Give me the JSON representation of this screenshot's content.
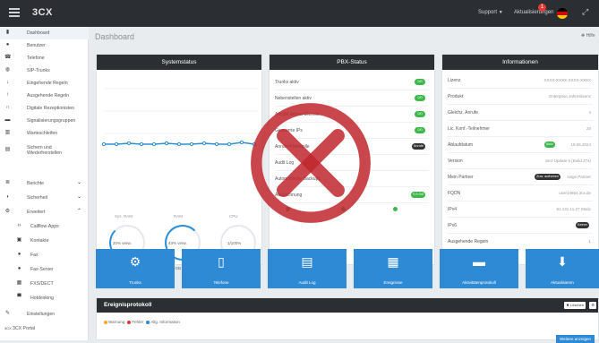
{
  "topbar": {
    "logo": "3CX",
    "support": "Support",
    "updates": "Aktualisierungen",
    "updates_badge": "1"
  },
  "sidebar": {
    "items": [
      {
        "label": "Dashboard",
        "icon": "chart-icon"
      },
      {
        "label": "Benutzer",
        "icon": "user-icon"
      },
      {
        "label": "Telefone",
        "icon": "phone-icon"
      },
      {
        "label": "SIP-Trunks",
        "icon": "globe-icon"
      },
      {
        "label": "Eingehende Regeln",
        "icon": "arrow-down-icon"
      },
      {
        "label": "Ausgehende Regeln",
        "icon": "arrow-up-icon"
      },
      {
        "label": "Digitale Rezeptionisten",
        "icon": "headset-icon"
      },
      {
        "label": "Signalisierungsgruppen",
        "icon": "group-icon"
      },
      {
        "label": "Warteschleifen",
        "icon": "queue-icon"
      },
      {
        "label": "Sichern und Wiederherstellen",
        "icon": "backup-icon"
      },
      {
        "label": "Berichte",
        "icon": "report-icon"
      },
      {
        "label": "Sicherheit",
        "icon": "shield-icon"
      },
      {
        "label": "Erweitert",
        "icon": "gear-icon"
      },
      {
        "label": "Callflow-Apps",
        "icon": "callflow-icon"
      },
      {
        "label": "Kontakte",
        "icon": "contacts-icon"
      },
      {
        "label": "Fax",
        "icon": "fax-icon"
      },
      {
        "label": "Fax-Server",
        "icon": "fax-server-icon"
      },
      {
        "label": "FXS/DECT",
        "icon": "dect-icon"
      },
      {
        "label": "Hotdesking",
        "icon": "hotdesk-icon"
      },
      {
        "label": "Einstellungen",
        "icon": "wrench-icon"
      },
      {
        "label": "3CX Portal",
        "icon": "portal-icon"
      }
    ]
  },
  "main": {
    "title": "Dashboard",
    "header_button": "Hilfe"
  },
  "system_status": {
    "title": "Systemstatus",
    "stats": [
      {
        "label": "Sys. RAM",
        "value": "20% verw.",
        "sub": "11,1 GB frei"
      },
      {
        "label": "RAM",
        "value": "43% verw.",
        "sub": "2,2 GB frei"
      },
      {
        "label": "CPU",
        "value": "1/100%",
        "sub": ""
      }
    ]
  },
  "pbx_status": {
    "title": "PBX-Status",
    "rows": [
      {
        "label": "Trunks aktiv",
        "value": "0/0"
      },
      {
        "label": "Nebenstellen aktiv",
        "value": "0/0"
      },
      {
        "label": "Anzahl aktiver Dienste",
        "value": "0/0"
      },
      {
        "label": "Gesperrte IPs",
        "value": "0/0"
      },
      {
        "label": "Anrufe-Protokolle",
        "value": "Anrufe"
      },
      {
        "label": "Audit Log",
        "value": ""
      },
      {
        "label": "Automatische Backups",
        "value": ""
      },
      {
        "label": "Aufzeichnung",
        "value": "0,9 GB"
      }
    ]
  },
  "info": {
    "title": "Informationen",
    "rows": [
      {
        "label": "Lizenz",
        "value": "XXXX-XXXX-XXXX-XXXX"
      },
      {
        "label": "Produkt",
        "value": "Enterprise Jahreslizenz"
      },
      {
        "label": "Gleichz. Anrufe",
        "value": "4"
      },
      {
        "label": "Lic. Konf.-Teilnehmer",
        "value": "20"
      },
      {
        "label": "Ablaufdatum",
        "value": "19.06.2024",
        "pill": "Aktiv"
      },
      {
        "label": "Version",
        "value": "18.0 Update 6 (Build 374)"
      },
      {
        "label": "Mein Partner",
        "value": "zeige Partner",
        "pill": "Zuw. aufheben"
      },
      {
        "label": "FQDN",
        "value": "user14654.3cx.de"
      },
      {
        "label": "IPv4",
        "value": "91.131.11.27 Static"
      },
      {
        "label": "IPv6",
        "value": "",
        "pill": "Keiner"
      },
      {
        "label": "Ausgehende Regeln",
        "value": "1"
      }
    ]
  },
  "tiles": [
    {
      "label": "Trunks",
      "icon": "gear-icon"
    },
    {
      "label": "Telefone",
      "icon": "phone-icon"
    },
    {
      "label": "Audit Log",
      "icon": "document-icon"
    },
    {
      "label": "Ereignisse",
      "icon": "calendar-icon"
    },
    {
      "label": "Aktivitätenprotokoll",
      "icon": "drive-icon"
    },
    {
      "label": "Aktualisieren",
      "icon": "download-icon"
    }
  ],
  "events": {
    "title": "Ereignisprotokoll",
    "btn_delete": "Löschen",
    "legend": [
      {
        "label": "Warnung",
        "color": "#f5a623"
      },
      {
        "label": "Fehler",
        "color": "#e53935"
      },
      {
        "label": "Allg. Information",
        "color": "#2f8ad6"
      }
    ],
    "more": "Weitere anzeigen"
  },
  "colors": {
    "accent": "#2f8ad6",
    "dark": "#2b2f33",
    "green": "#3db84a",
    "error_overlay": "#c0272d"
  }
}
